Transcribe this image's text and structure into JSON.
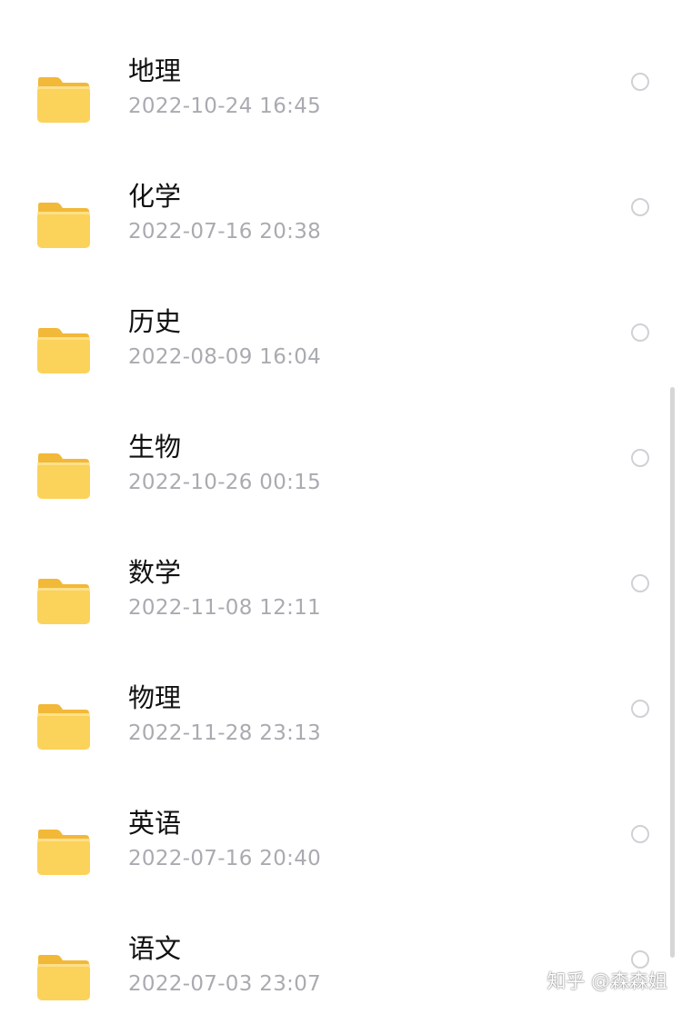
{
  "colors": {
    "folder_body": "#fbd25a",
    "folder_back": "#f2b838",
    "name_text": "#111111",
    "date_text": "#a9abb0",
    "radio_border": "#cfd1d5",
    "scrollbar": "#d6d6d8"
  },
  "icons": {
    "folder": "folder-icon",
    "select": "radio-circle-icon"
  },
  "folders": [
    {
      "name": "地理",
      "modified": "2022-10-24 16:45"
    },
    {
      "name": "化学",
      "modified": "2022-07-16 20:38"
    },
    {
      "name": "历史",
      "modified": "2022-08-09 16:04"
    },
    {
      "name": "生物",
      "modified": "2022-10-26 00:15"
    },
    {
      "name": "数学",
      "modified": "2022-11-08 12:11"
    },
    {
      "name": "物理",
      "modified": "2022-11-28 23:13"
    },
    {
      "name": "英语",
      "modified": "2022-07-16 20:40"
    },
    {
      "name": "语文",
      "modified": "2022-07-03 23:07"
    }
  ],
  "watermark": "知乎 @森森姐"
}
